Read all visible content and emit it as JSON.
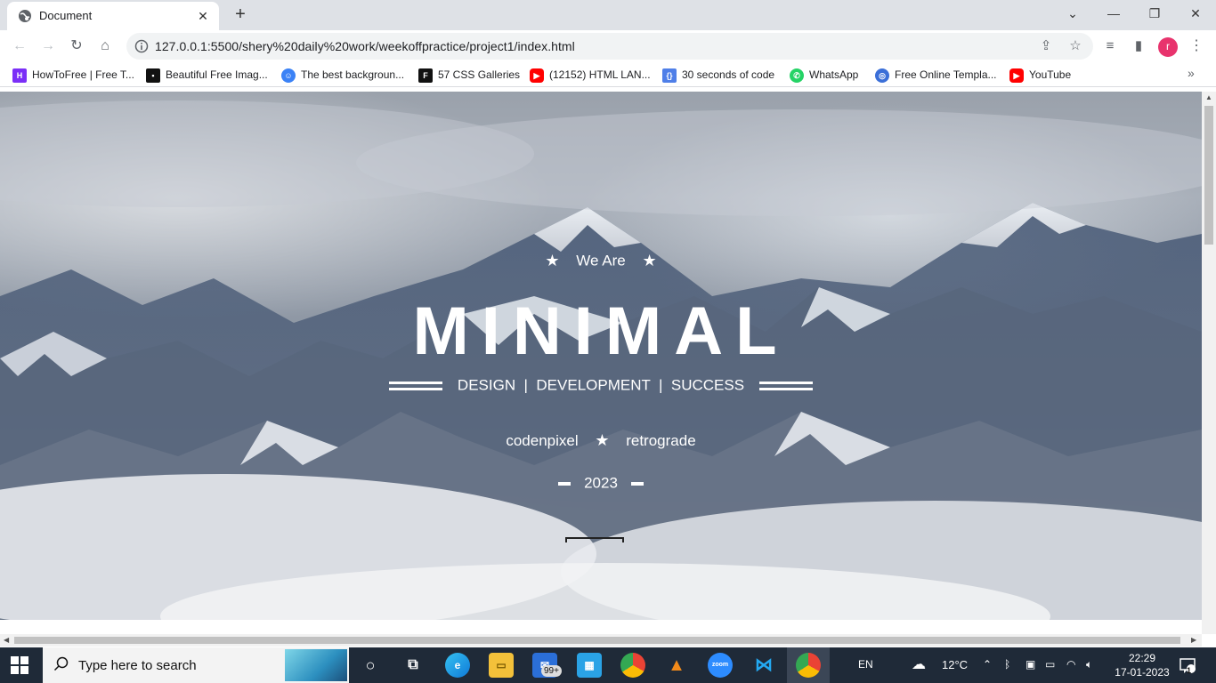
{
  "browser": {
    "tab_title": "Document",
    "url": "127.0.0.1:5500/shery%20daily%20work/weekoffpractice/project1/index.html",
    "profile_initial": "r"
  },
  "bookmarks": [
    {
      "label": "HowToFree | Free T...",
      "icon": "howtofree-icon",
      "color": "#7b2ff7"
    },
    {
      "label": "Beautiful Free Imag...",
      "icon": "unsplash-icon",
      "color": "#111111"
    },
    {
      "label": "The best backgroun...",
      "icon": "robot-icon",
      "color": "#3b82f6"
    },
    {
      "label": "57 CSS Galleries",
      "icon": "f-icon",
      "color": "#111111"
    },
    {
      "label": "(12152) HTML LAN...",
      "icon": "youtube-icon",
      "color": "#ff0000"
    },
    {
      "label": "30 seconds of code",
      "icon": "code-icon",
      "color": "#4f7fe8"
    },
    {
      "label": "WhatsApp",
      "icon": "whatsapp-icon",
      "color": "#25d366"
    },
    {
      "label": "Free Online Templa...",
      "icon": "globe-icon",
      "color": "#3b6fd8"
    },
    {
      "label": "YouTube",
      "icon": "youtube-icon",
      "color": "#ff0000"
    }
  ],
  "hero": {
    "we_are": "We Are",
    "title": "MINIMAL",
    "tagline": "DESIGN  |  DEVELOPMENT  |  SUCCESS",
    "name_left": "codenpixel",
    "name_right": "retrograde",
    "year": "2023"
  },
  "taskbar": {
    "search_placeholder": "Type here to search",
    "mail_badge": "99+",
    "language": "EN",
    "temperature": "12°C",
    "time": "22:29",
    "date": "17-01-2023",
    "notification_count": "1"
  }
}
